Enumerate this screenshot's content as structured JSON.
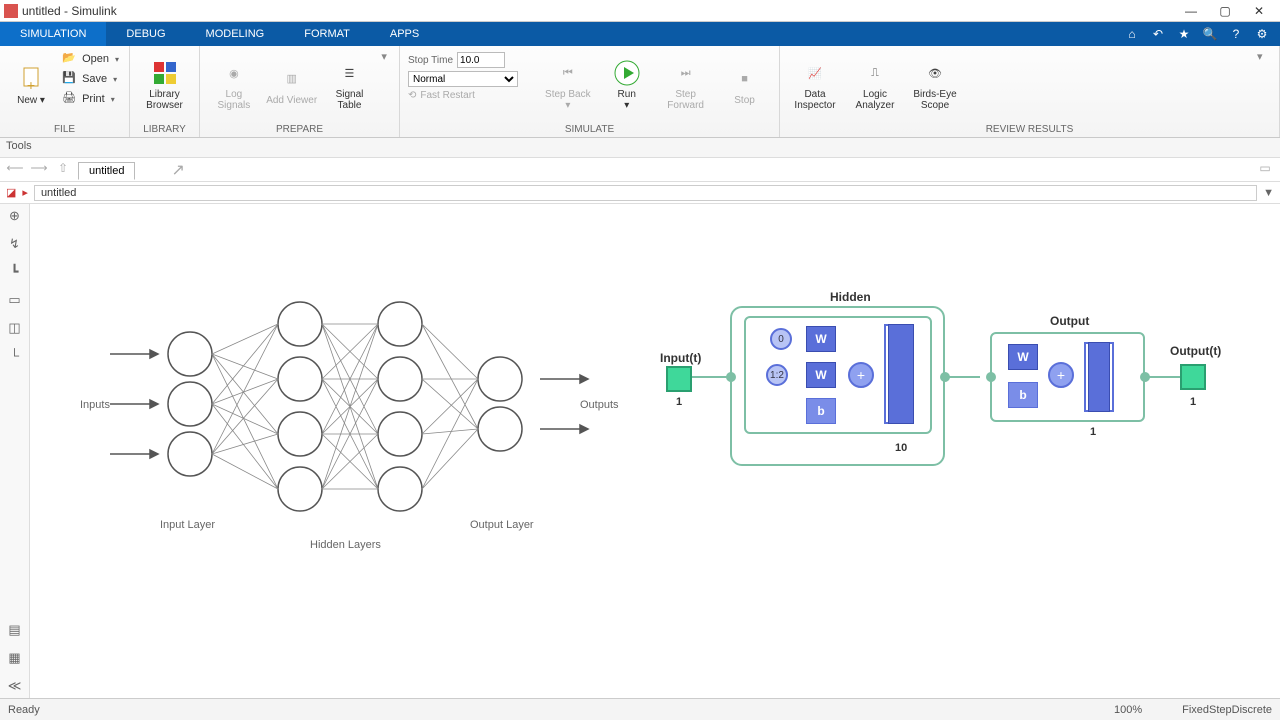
{
  "window": {
    "title": "untitled - Simulink"
  },
  "tabs": {
    "simulation": "SIMULATION",
    "debug": "DEBUG",
    "modeling": "MODELING",
    "format": "FORMAT",
    "apps": "APPS"
  },
  "file": {
    "new": "New",
    "open": "Open",
    "save": "Save",
    "print": "Print",
    "group": "FILE"
  },
  "library": {
    "browser": "Library\nBrowser",
    "group": "LIBRARY"
  },
  "prepare": {
    "log": "Log\nSignals",
    "add": "Add\nViewer",
    "table": "Signal\nTable",
    "group": "PREPARE"
  },
  "simulate": {
    "stoptime_label": "Stop Time",
    "stoptime_value": "10.0",
    "mode": "Normal",
    "restart": "Fast Restart",
    "stepback": "Step\nBack",
    "run": "Run",
    "stepfwd": "Step\nForward",
    "stop": "Stop",
    "group": "SIMULATE"
  },
  "review": {
    "di": "Data\nInspector",
    "la": "Logic\nAnalyzer",
    "bs": "Birds-Eye\nScope",
    "group": "REVIEW RESULTS"
  },
  "toolstrip": "Tools",
  "doc": {
    "tab": "untitled",
    "crumb": "untitled"
  },
  "canvas_labels": {
    "inputs": "Inputs",
    "outputs": "Outputs",
    "input_layer": "Input Layer",
    "hidden_layers": "Hidden Layers",
    "output_layer": "Output Layer",
    "hidden_block": "Hidden",
    "output_block": "Output",
    "input_t": "Input(t)",
    "output_t": "Output(t)",
    "one_a": "1",
    "one_b": "1",
    "one_c": "1",
    "ten": "10",
    "w": "W",
    "b": "b",
    "zero": "0",
    "ratio": "1:2",
    "plus": "+"
  },
  "status": {
    "ready": "Ready",
    "zoom": "100%",
    "solver": "FixedStepDiscrete"
  }
}
